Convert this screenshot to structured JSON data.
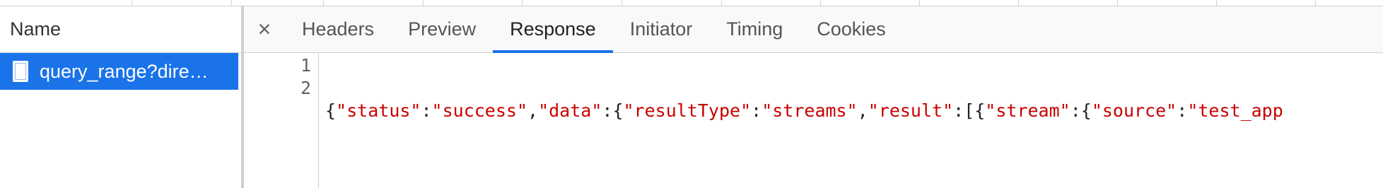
{
  "name_panel": {
    "header": "Name",
    "rows": [
      {
        "label": "query_range?dire…",
        "selected": true,
        "icon": "document-icon"
      }
    ]
  },
  "detail": {
    "close_label": "×",
    "tabs": [
      {
        "label": "Headers",
        "active": false
      },
      {
        "label": "Preview",
        "active": false
      },
      {
        "label": "Response",
        "active": true
      },
      {
        "label": "Initiator",
        "active": false
      },
      {
        "label": "Timing",
        "active": false
      },
      {
        "label": "Cookies",
        "active": false
      }
    ],
    "response": {
      "line_numbers": [
        "1",
        "2"
      ],
      "line1_tokens": [
        {
          "t": "{",
          "k": "punc"
        },
        {
          "t": "\"status\"",
          "k": "str"
        },
        {
          "t": ":",
          "k": "punc"
        },
        {
          "t": "\"success\"",
          "k": "str"
        },
        {
          "t": ",",
          "k": "punc"
        },
        {
          "t": "\"data\"",
          "k": "str"
        },
        {
          "t": ":{",
          "k": "punc"
        },
        {
          "t": "\"resultType\"",
          "k": "str"
        },
        {
          "t": ":",
          "k": "punc"
        },
        {
          "t": "\"streams\"",
          "k": "str"
        },
        {
          "t": ",",
          "k": "punc"
        },
        {
          "t": "\"result\"",
          "k": "str"
        },
        {
          "t": ":[{",
          "k": "punc"
        },
        {
          "t": "\"stream\"",
          "k": "str"
        },
        {
          "t": ":{",
          "k": "punc"
        },
        {
          "t": "\"source\"",
          "k": "str"
        },
        {
          "t": ":",
          "k": "punc"
        },
        {
          "t": "\"test_app",
          "k": "str"
        }
      ],
      "line2": ""
    }
  },
  "colors": {
    "accent": "#1a73e8",
    "string": "#c80000"
  }
}
